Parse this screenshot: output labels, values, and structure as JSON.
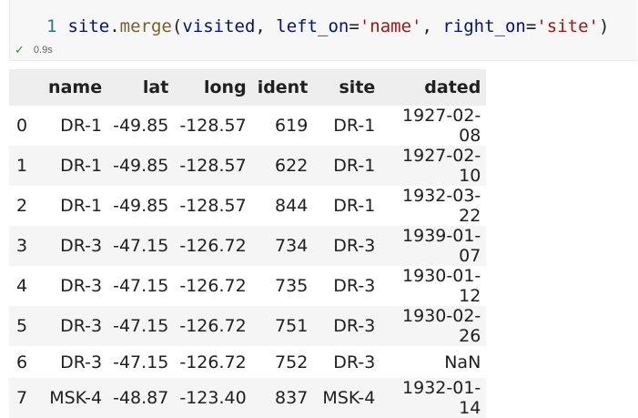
{
  "cell": {
    "line_number": "1",
    "code": {
      "obj": "site",
      "dot": ".",
      "fn": "merge",
      "open": "(",
      "arg1": "visited",
      "sep1": ", ",
      "kw1": "left_on",
      "eq1": "=",
      "str1": "'name'",
      "sep2": ", ",
      "kw2": "right_on",
      "eq2": "=",
      "str2": "'site'",
      "close": ")"
    },
    "exec_time": "0.9s",
    "status_icon": "check-icon"
  },
  "table": {
    "index_header": "",
    "columns": [
      "name",
      "lat",
      "long",
      "ident",
      "site",
      "dated"
    ],
    "rows": [
      {
        "index": "0",
        "cells": [
          "DR-1",
          "-49.85",
          "-128.57",
          "619",
          "DR-1",
          "1927-02-08"
        ]
      },
      {
        "index": "1",
        "cells": [
          "DR-1",
          "-49.85",
          "-128.57",
          "622",
          "DR-1",
          "1927-02-10"
        ]
      },
      {
        "index": "2",
        "cells": [
          "DR-1",
          "-49.85",
          "-128.57",
          "844",
          "DR-1",
          "1932-03-22"
        ]
      },
      {
        "index": "3",
        "cells": [
          "DR-3",
          "-47.15",
          "-126.72",
          "734",
          "DR-3",
          "1939-01-07"
        ]
      },
      {
        "index": "4",
        "cells": [
          "DR-3",
          "-47.15",
          "-126.72",
          "735",
          "DR-3",
          "1930-01-12"
        ]
      },
      {
        "index": "5",
        "cells": [
          "DR-3",
          "-47.15",
          "-126.72",
          "751",
          "DR-3",
          "1930-02-26"
        ]
      },
      {
        "index": "6",
        "cells": [
          "DR-3",
          "-47.15",
          "-126.72",
          "752",
          "DR-3",
          "NaN"
        ]
      },
      {
        "index": "7",
        "cells": [
          "MSK-4",
          "-48.87",
          "-123.40",
          "837",
          "MSK-4",
          "1932-01-14"
        ]
      }
    ]
  },
  "colors": {
    "header_bg": "#eeeeee",
    "row_stripe": "#f5f5f5",
    "success": "#388a34"
  }
}
